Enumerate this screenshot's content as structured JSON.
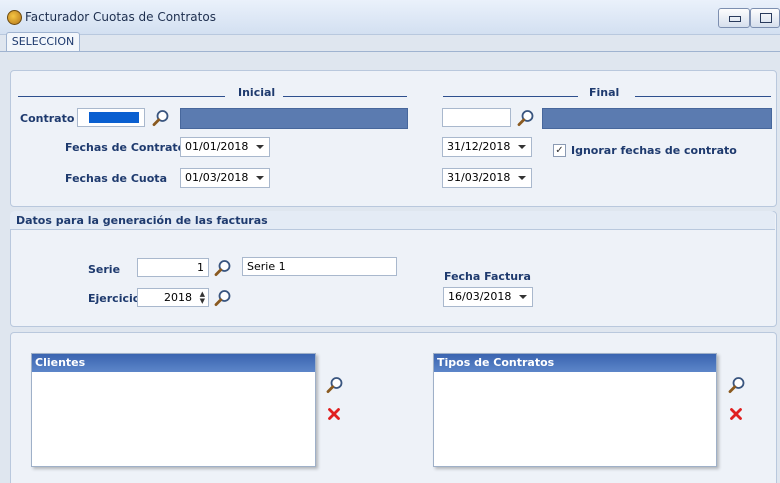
{
  "window": {
    "title": "Facturador Cuotas de Contratos"
  },
  "tabs": [
    {
      "label": "SELECCION"
    }
  ],
  "range": {
    "inicial_label": "Inicial",
    "final_label": "Final",
    "contrato_label": "Contrato",
    "fechas_contrato_label": "Fechas  de Contrato",
    "fechas_cuota_label": "Fechas  de Cuota",
    "inicial": {
      "contrato_value": "",
      "fecha_contrato": "01/01/2018",
      "fecha_cuota": "01/03/2018"
    },
    "final": {
      "contrato_value": "",
      "fecha_contrato": "31/12/2018",
      "fecha_cuota": "31/03/2018"
    },
    "ignorar_label": "Ignorar fechas de contrato",
    "ignorar_checked": "✓"
  },
  "datos": {
    "title": "Datos para la generación de las facturas",
    "serie_label": "Serie",
    "serie_value": "1",
    "serie_name": "Serie 1",
    "ejercicio_label": "Ejercicio",
    "ejercicio_value": "2018",
    "fecha_factura_label": "Fecha Factura",
    "fecha_factura_value": "16/03/2018"
  },
  "lists": {
    "clientes_label": "Clientes",
    "tipos_label": "Tipos de Contratos"
  },
  "colors": {
    "accent": "#1e3a6e",
    "header": "#3a64b0",
    "field_fill": "#5b7bb0",
    "delete": "#e02020"
  },
  "icons": [
    "app-icon",
    "search-icon",
    "delete-icon",
    "minimize-icon",
    "restore-icon",
    "chevron-down-icon",
    "checkmark-icon"
  ]
}
